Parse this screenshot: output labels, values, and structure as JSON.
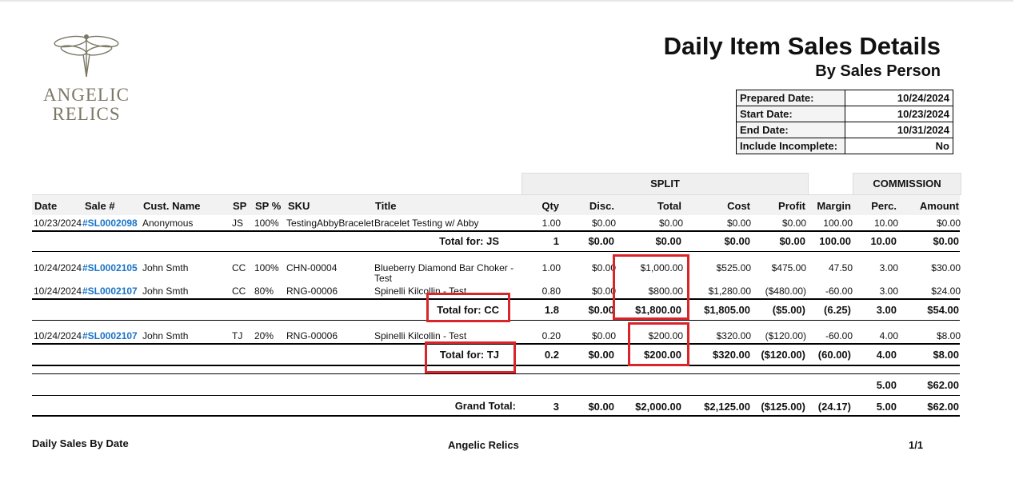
{
  "logo": {
    "line1": "ANGELIC",
    "line2": "RELICS"
  },
  "report": {
    "title": "Daily Item Sales Details",
    "subtitle": "By Sales Person"
  },
  "info": [
    {
      "label": "Prepared Date:",
      "value": "10/24/2024"
    },
    {
      "label": "Start Date:",
      "value": "10/23/2024"
    },
    {
      "label": "End Date:",
      "value": "10/31/2024"
    },
    {
      "label": "Include Incomplete:",
      "value": "No"
    }
  ],
  "bands": {
    "split": "SPLIT",
    "commission": "COMMISSION"
  },
  "columns": {
    "date": "Date",
    "sale": "Sale #",
    "cust": "Cust. Name",
    "sp": "SP",
    "sp_pct": "SP %",
    "sku": "SKU",
    "title": "Title",
    "qty": "Qty",
    "disc": "Disc.",
    "total": "Total",
    "cost": "Cost",
    "profit": "Profit",
    "margin": "Margin",
    "perc": "Perc.",
    "amount": "Amount"
  },
  "rows": [
    {
      "date": "10/23/2024",
      "sale": "#SL0002098",
      "cust": "Anonymous",
      "sp": "JS",
      "sp_pct": "100%",
      "sku": "TestingAbbyBracelet",
      "title": "Bracelet Testing w/ Abby",
      "title2": "",
      "qty": "1.00",
      "disc": "$0.00",
      "total": "$0.00",
      "cost": "$0.00",
      "profit": "$0.00",
      "margin": "100.00",
      "perc": "10.00",
      "amount": "$0.00"
    },
    {
      "date": "10/24/2024",
      "sale": "#SL0002105",
      "cust": "John  Smth",
      "sp": "CC",
      "sp_pct": "100%",
      "sku": "CHN-00004",
      "title": "Blueberry Diamond Bar Choker -",
      "title2": "Test",
      "qty": "1.00",
      "disc": "$0.00",
      "total": "$1,000.00",
      "cost": "$525.00",
      "profit": "$475.00",
      "margin": "47.50",
      "perc": "3.00",
      "amount": "$30.00"
    },
    {
      "date": "10/24/2024",
      "sale": "#SL0002107",
      "cust": "John  Smth",
      "sp": "CC",
      "sp_pct": "80%",
      "sku": "RNG-00006",
      "title": "Spinelli Kilcollin - Test",
      "title2": "",
      "qty": "0.80",
      "disc": "$0.00",
      "total": "$800.00",
      "cost": "$1,280.00",
      "profit": "($480.00)",
      "margin": "-60.00",
      "perc": "3.00",
      "amount": "$24.00"
    },
    {
      "date": "10/24/2024",
      "sale": "#SL0002107",
      "cust": "John  Smth",
      "sp": "TJ",
      "sp_pct": "20%",
      "sku": "RNG-00006",
      "title": "Spinelli Kilcollin - Test",
      "title2": "",
      "qty": "0.20",
      "disc": "$0.00",
      "total": "$200.00",
      "cost": "$320.00",
      "profit": "($120.00)",
      "margin": "-60.00",
      "perc": "4.00",
      "amount": "$8.00"
    }
  ],
  "totals": [
    {
      "label": "Total for: JS",
      "qty": "1",
      "disc": "$0.00",
      "total": "$0.00",
      "cost": "$0.00",
      "profit": "$0.00",
      "margin": "100.00",
      "perc": "10.00",
      "amount": "$0.00"
    },
    {
      "label": "Total for: CC",
      "qty": "1.8",
      "disc": "$0.00",
      "total": "$1,800.00",
      "cost": "$1,805.00",
      "profit": "($5.00)",
      "margin": "(6.25)",
      "perc": "3.00",
      "amount": "$54.00"
    },
    {
      "label": "Total for: TJ",
      "qty": "0.2",
      "disc": "$0.00",
      "total": "$200.00",
      "cost": "$320.00",
      "profit": "($120.00)",
      "margin": "(60.00)",
      "perc": "4.00",
      "amount": "$8.00"
    }
  ],
  "commission_summary": {
    "perc": "5.00",
    "amount": "$62.00"
  },
  "grand_total": {
    "label": "Grand Total:",
    "qty": "3",
    "disc": "$0.00",
    "total": "$2,000.00",
    "cost": "$2,125.00",
    "profit": "($125.00)",
    "margin": "(24.17)",
    "perc": "5.00",
    "amount": "$62.00"
  },
  "footer": {
    "left": "Daily Sales By Date",
    "center": "Angelic Relics",
    "page": "1/1"
  },
  "highlight_color": "#d9252a"
}
